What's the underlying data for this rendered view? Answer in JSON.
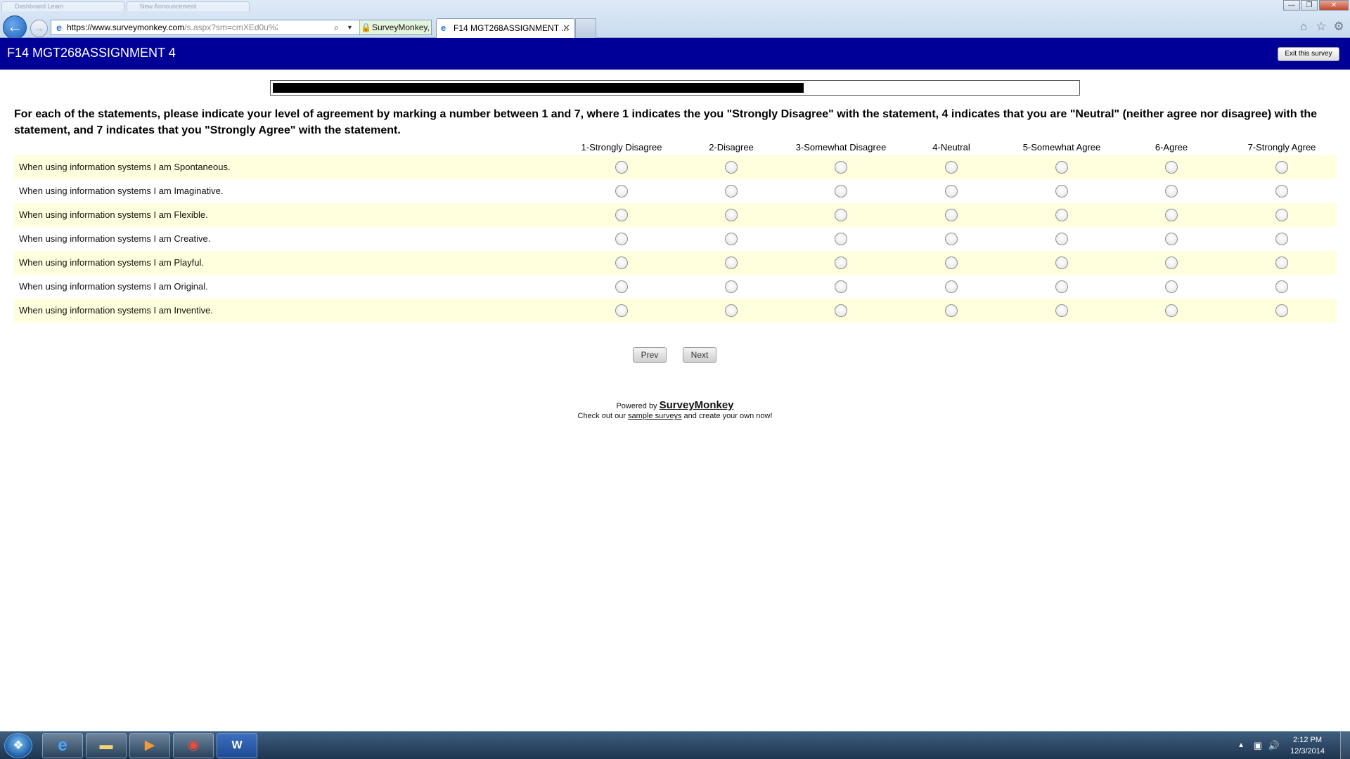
{
  "browser": {
    "ghost_tabs": [
      "Dashboard Learn",
      "New Announcement"
    ],
    "window_controls": {
      "minimize": "—",
      "maximize": "❐",
      "close": "✕"
    },
    "back_icon": "back-arrow-icon",
    "forward_icon": "forward-arrow-icon",
    "url_host": "https://www.surveymonkey.com",
    "url_rest": "/s.aspx?sm=cmXEd0u%2",
    "cert_label": "SurveyMonkey, Inc [...",
    "active_tab_title": "F14 MGT268ASSIGNMENT ...",
    "tab_close": "✕",
    "tool_icons": [
      "home-icon",
      "favorites-star-icon",
      "settings-gear-icon"
    ]
  },
  "survey": {
    "title": "F14 MGT268ASSIGNMENT 4",
    "exit_label": "Exit this survey",
    "progress_fraction": 0.66,
    "question": "For each of the statements, please indicate your level of agreement by marking a number between 1 and 7, where 1 indicates the you \"Strongly Disagree\" with the statement, 4 indicates that you are \"Neutral\" (neither agree nor disagree) with the statement, and 7 indicates that you \"Strongly Agree\" with the statement.",
    "columns": [
      "1-Strongly Disagree",
      "2-Disagree",
      "3-Somewhat Disagree",
      "4-Neutral",
      "5-Somewhat Agree",
      "6-Agree",
      "7-Strongly Agree"
    ],
    "rows": [
      "When using information systems I am Spontaneous.",
      "When using information systems I am Imaginative.",
      "When using information systems I am Flexible.",
      "When using information systems I am Creative.",
      "When using information systems I am Playful.",
      "When using information systems I am Original.",
      "When using information systems I am Inventive."
    ],
    "prev_label": "Prev",
    "next_label": "Next",
    "row_stripe_color": "#ffffdd",
    "header_color": "#000099"
  },
  "footer": {
    "powered_by": "Powered by",
    "brand": "SurveyMonkey",
    "line2_prefix": "Check out our",
    "link_text": "sample surveys",
    "line2_suffix": "and create your own now!"
  },
  "taskbar": {
    "apps": [
      "windows-start-icon",
      "internet-explorer-icon",
      "file-explorer-icon",
      "media-player-icon",
      "chrome-icon",
      "word-icon"
    ],
    "word_letter": "W",
    "time": "2:12 PM",
    "date": "12/3/2014"
  }
}
